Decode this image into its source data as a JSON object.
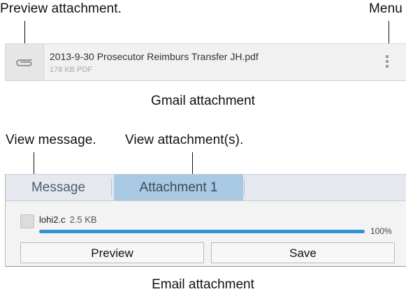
{
  "gmail": {
    "callout_preview": "Preview attachment.",
    "callout_menu": "Menu",
    "file_name": "2013-9-30  Prosecutor Reimburs Transfer  JH.pdf",
    "file_meta": "178 KB PDF",
    "caption": "Gmail attachment",
    "icons": [
      "paperclip-icon",
      "overflow-menu-icon"
    ]
  },
  "email": {
    "callout_message": "View message.",
    "callout_attachments": "View attachment(s).",
    "tabs": [
      {
        "label": "Message",
        "selected": false
      },
      {
        "label": "Attachment 1",
        "selected": true
      }
    ],
    "attachment": {
      "name": "lohi2.c",
      "size": "2.5 KB",
      "progress_label": "100%",
      "progress": 1.0
    },
    "buttons": {
      "preview": "Preview",
      "save": "Save"
    },
    "caption": "Email attachment"
  },
  "colors": {
    "tab_selected": "#a9c8e3",
    "tab_bar": "#e5e9ef",
    "progress": "#2f93d6"
  }
}
